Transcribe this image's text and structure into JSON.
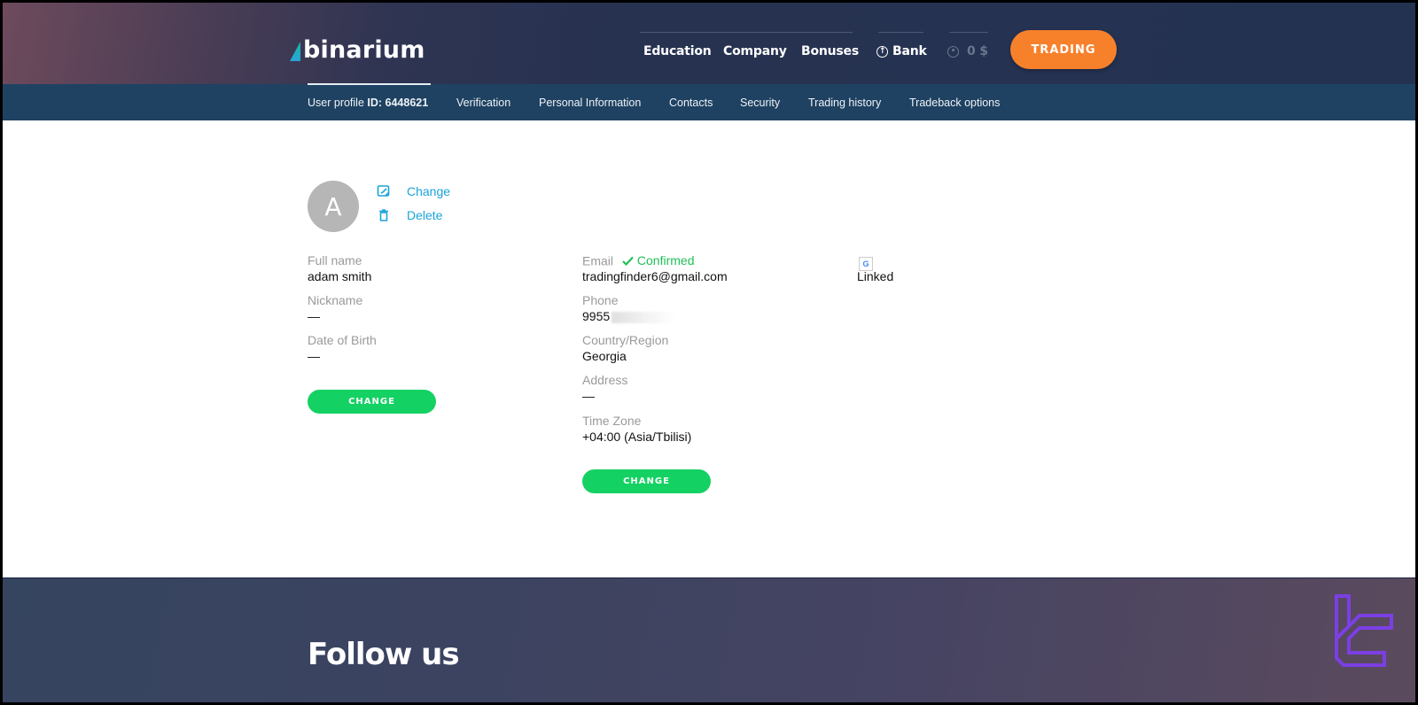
{
  "header": {
    "logo_text": "binarium",
    "nav": [
      {
        "label": "Education"
      },
      {
        "label": "Company"
      },
      {
        "label": "Bonuses"
      },
      {
        "label": "Bank",
        "icon": "upload-circle-icon"
      },
      {
        "label": "0 $",
        "icon": "user-circle-icon"
      }
    ],
    "trading_button": "TRADING"
  },
  "subnav": {
    "profile_prefix": "User profile ",
    "profile_id_label": "ID: 6448621",
    "items": [
      {
        "label": "Verification"
      },
      {
        "label": "Personal Information"
      },
      {
        "label": "Contacts"
      },
      {
        "label": "Security"
      },
      {
        "label": "Trading history"
      },
      {
        "label": "Tradeback options"
      }
    ]
  },
  "profile": {
    "avatar_letter": "A",
    "change_photo": "Change",
    "delete_photo": "Delete",
    "personal": {
      "full_name_label": "Full name",
      "full_name": "adam smith",
      "nickname_label": "Nickname",
      "nickname": "—",
      "dob_label": "Date of Birth",
      "dob": "—",
      "change_button": "CHANGE"
    },
    "contacts": {
      "email_label": "Email",
      "email_status": "Confirmed",
      "email": "tradingfinder6@gmail.com",
      "phone_label": "Phone",
      "phone": "9955",
      "country_label": "Country/Region",
      "country": "Georgia",
      "address_label": "Address",
      "address": "—",
      "timezone_label": "Time Zone",
      "timezone": "+04:00 (Asia/Tbilisi)",
      "change_button": "CHANGE"
    },
    "social": {
      "google_icon_letter": "G",
      "status": "Linked"
    }
  },
  "footer": {
    "title": "Follow us"
  },
  "colors": {
    "accent_orange": "#f7812b",
    "accent_green": "#14d163",
    "link_blue": "#1aa3d9",
    "confirmed_green": "#1fbf57",
    "subnav_bg": "#1f4262"
  }
}
